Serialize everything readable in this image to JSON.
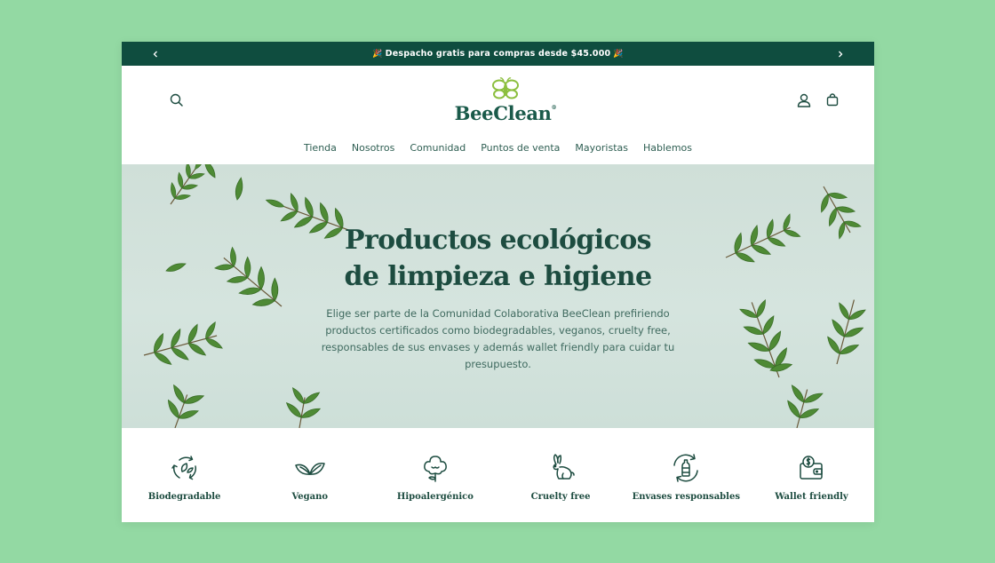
{
  "announcement": {
    "text": "Despacho gratis para compras desde $45.000",
    "prev_icon": "chevron-left-icon",
    "next_icon": "chevron-right-icon"
  },
  "brand": {
    "name": "BeeClean",
    "registered": "®",
    "color": "#1a5a4a",
    "accent": "#8cbf3f"
  },
  "nav": {
    "items": [
      {
        "label": "Tienda"
      },
      {
        "label": "Nosotros"
      },
      {
        "label": "Comunidad"
      },
      {
        "label": "Puntos de venta"
      },
      {
        "label": "Mayoristas"
      },
      {
        "label": "Hablemos"
      }
    ]
  },
  "hero": {
    "title_line1": "Productos ecológicos",
    "title_line2": "de limpieza e higiene",
    "description": "Elige ser parte de la Comunidad Colaborativa BeeClean prefiriendo productos certificados como biodegradables, veganos, cruelty free, responsables de sus envases y además wallet friendly para cuidar tu presupuesto."
  },
  "features": [
    {
      "label": "Biodegradable",
      "icon": "recycle-leaves-icon"
    },
    {
      "label": "Vegano",
      "icon": "leaves-icon"
    },
    {
      "label": "Hipoalergénico",
      "icon": "cotton-flower-icon"
    },
    {
      "label": "Cruelty free",
      "icon": "rabbit-icon"
    },
    {
      "label": "Envases responsables",
      "icon": "bottle-recycle-icon"
    },
    {
      "label": "Wallet friendly",
      "icon": "wallet-icon"
    }
  ],
  "colors": {
    "page_bg": "#93d9a3",
    "dark_green": "#0f4d3f",
    "text_green": "#1d4c40",
    "leaf": "#3f7a2a"
  }
}
